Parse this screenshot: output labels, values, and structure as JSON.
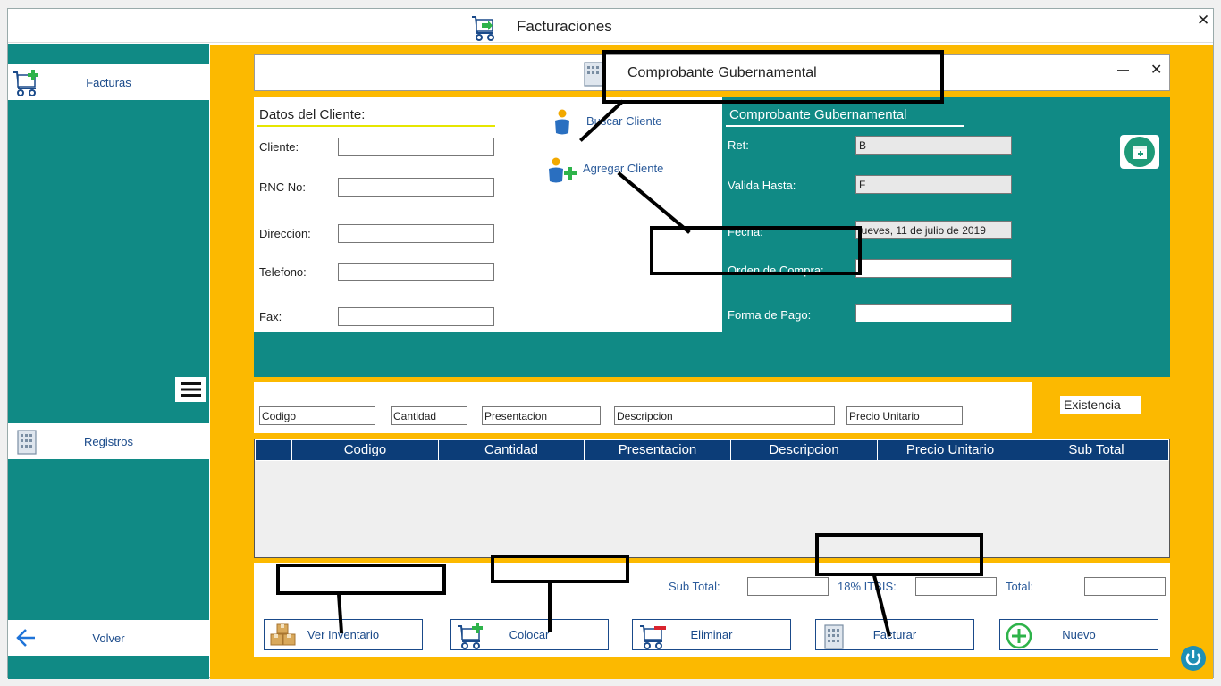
{
  "window": {
    "title": "Facturaciones",
    "minimize_glyph": "—",
    "close_glyph": "✕"
  },
  "sidebar": {
    "items": [
      {
        "label": "Facturas",
        "icon": "cart-add-icon"
      },
      {
        "label": "Registros",
        "icon": "building-icon"
      },
      {
        "label": "Volver",
        "icon": "arrow-left-icon"
      }
    ],
    "menu_icon": "hamburger-menu-icon"
  },
  "dialog": {
    "title": "Comprobante Gubernamental",
    "minimize_glyph": "—",
    "close_glyph": "✕"
  },
  "client": {
    "heading": "Datos del Cliente:",
    "fields": [
      {
        "label": "Cliente:",
        "value": ""
      },
      {
        "label": "RNC No:",
        "value": ""
      },
      {
        "label": "Direccion:",
        "value": ""
      },
      {
        "label": "Telefono:",
        "value": ""
      },
      {
        "label": "Fax:",
        "value": ""
      }
    ],
    "buscar_label": "Buscar Cliente",
    "agregar_label": "Agregar Cliente"
  },
  "gov": {
    "heading": "Comprobante Gubernamental",
    "fields": [
      {
        "label": "Ret:",
        "value": "B"
      },
      {
        "label": "Valida Hasta:",
        "value": "F"
      },
      {
        "label": "Fecha:",
        "value": "jueves, 11 de julio de 2019"
      },
      {
        "label": "Orden de Compra:",
        "value": ""
      },
      {
        "label": "Forma de Pago:",
        "value": ""
      }
    ],
    "calendar_icon": "calendar-add-icon"
  },
  "entry": {
    "placeholders": [
      "Codigo",
      "Cantidad",
      "Presentacion",
      "Descripcion",
      "Precio Unitario"
    ],
    "existencia_label": "Existencia"
  },
  "grid": {
    "columns": [
      "",
      "Codigo",
      "Cantidad",
      "Presentacion",
      "Descripcion",
      "Precio Unitario",
      "Sub Total"
    ],
    "rows": []
  },
  "totals": {
    "subtotal_label": "Sub Total:",
    "itbis_label": "18% ITBIS:",
    "total_label": "Total:",
    "subtotal_value": "",
    "itbis_value": "",
    "total_value": ""
  },
  "actions": [
    {
      "label": "Ver Inventario",
      "icon": "boxes-icon"
    },
    {
      "label": "Colocar",
      "icon": "cart-add-icon"
    },
    {
      "label": "Eliminar",
      "icon": "cart-remove-icon"
    },
    {
      "label": "Facturar",
      "icon": "building-icon"
    },
    {
      "label": "Nuevo",
      "icon": "plus-circle-icon"
    }
  ],
  "colors": {
    "teal": "#108a85",
    "yellow": "#fcb900",
    "navy": "#0c3d78",
    "accent_green": "#2eb34a"
  }
}
